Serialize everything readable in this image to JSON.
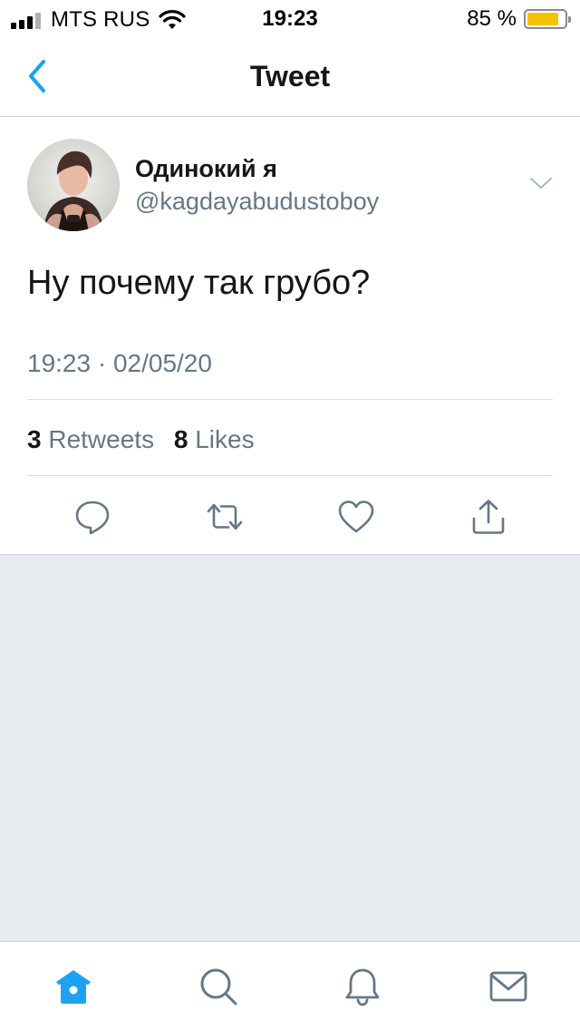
{
  "status_bar": {
    "carrier": "MTS RUS",
    "time": "19:23",
    "battery_percent_label": "85 %",
    "battery_level": 0.85,
    "icons": [
      "signal-icon",
      "wifi-icon",
      "battery-icon"
    ]
  },
  "nav": {
    "title": "Tweet",
    "back_icon": "chevron-left-icon"
  },
  "tweet": {
    "display_name": "Одинокий я",
    "handle": "@kagdayabudustoboy",
    "text": "Ну почему так грубо?",
    "timestamp": "19:23 · 02/05/20",
    "retweets_count": "3",
    "retweets_label": "Retweets",
    "likes_count": "8",
    "likes_label": "Likes",
    "actions": [
      "reply-icon",
      "retweet-icon",
      "like-icon",
      "share-icon"
    ]
  },
  "tab_bar": {
    "tabs": [
      "home-icon",
      "search-icon",
      "notifications-icon",
      "messages-icon"
    ],
    "active": "home-icon"
  },
  "colors": {
    "accent": "#1da1f2",
    "secondary_text": "#657786",
    "icon_gray": "#657786",
    "background": "#e6ecf0"
  }
}
